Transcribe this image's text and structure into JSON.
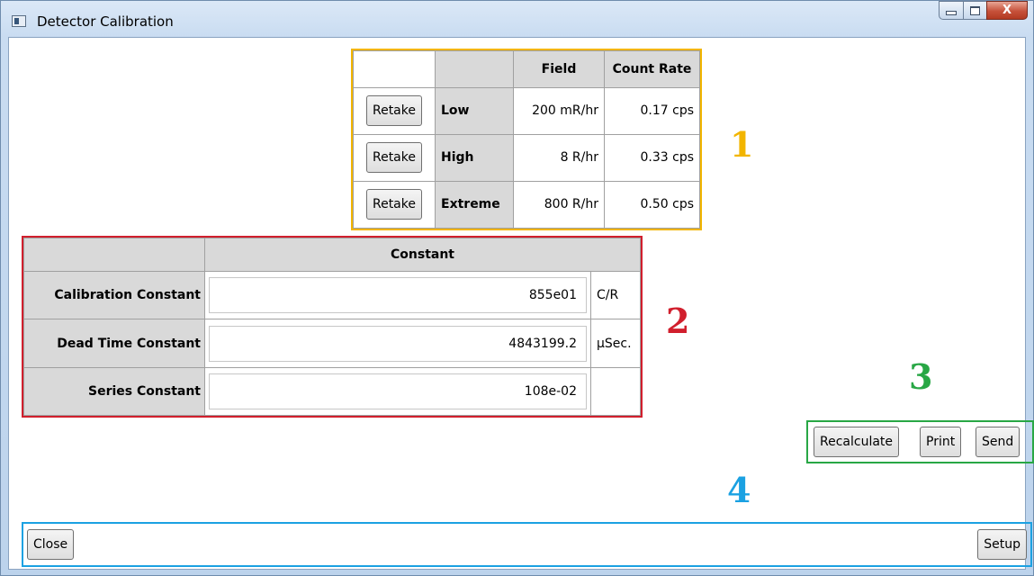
{
  "window": {
    "title": "Detector Calibration",
    "caption_buttons": {
      "close": "X"
    }
  },
  "section_numbers": [
    "1",
    "2",
    "3",
    "4"
  ],
  "colors": {
    "section1": "#f2b500",
    "section2": "#d11f2d",
    "section3": "#28a745",
    "section4": "#1ba1e2"
  },
  "field_table": {
    "headers": [
      "",
      "",
      "Field",
      "Count Rate"
    ],
    "rows": [
      {
        "button": "Retake",
        "label": "Low",
        "field": "200 mR/hr",
        "count_rate": "0.17 cps"
      },
      {
        "button": "Retake",
        "label": "High",
        "field": "8 R/hr",
        "count_rate": "0.33 cps"
      },
      {
        "button": "Retake",
        "label": "Extreme",
        "field": "800 R/hr",
        "count_rate": "0.50 cps"
      }
    ]
  },
  "constant_table": {
    "header": "Constant",
    "rows": [
      {
        "label": "Calibration Constant",
        "value": "855e01",
        "unit": "C/R"
      },
      {
        "label": "Dead Time Constant",
        "value": "4843199.2",
        "unit": "μSec."
      },
      {
        "label": "Series Constant",
        "value": "108e-02",
        "unit": ""
      }
    ]
  },
  "actions": {
    "recalculate": "Recalculate",
    "print": "Print",
    "send": "Send"
  },
  "footer": {
    "close": "Close",
    "setup": "Setup"
  }
}
